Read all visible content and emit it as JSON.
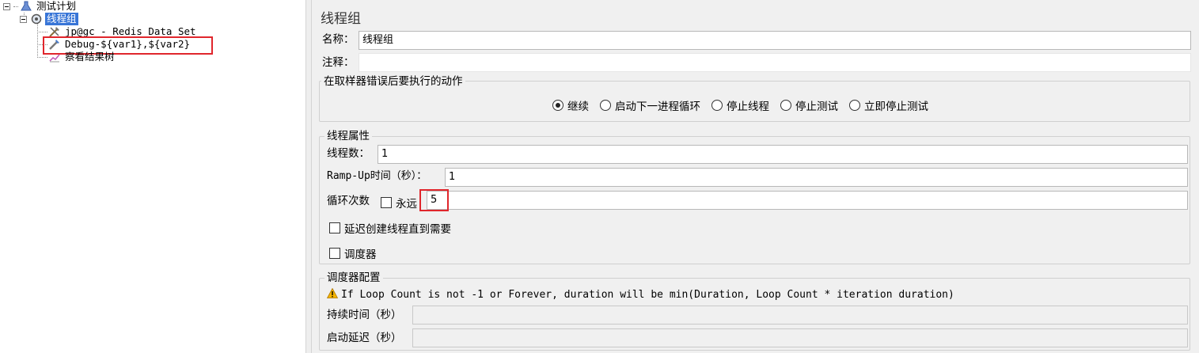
{
  "tree": {
    "items": [
      {
        "label": "测试计划",
        "icon": "flask-icon"
      },
      {
        "label": "线程组",
        "icon": "gear-icon"
      },
      {
        "label": "jp@gc - Redis Data Set",
        "icon": "tools-icon"
      },
      {
        "label": "Debug-${var1},${var2}",
        "icon": "pipette-icon"
      },
      {
        "label": "察看结果树",
        "icon": "chart-icon"
      }
    ]
  },
  "panel": {
    "title": "线程组",
    "name_label": "名称：",
    "name_value": "线程组",
    "comment_label": "注释：",
    "comment_value": "",
    "sampler_error": {
      "title": "在取样器错误后要执行的动作",
      "options": [
        "继续",
        "启动下一进程循环",
        "停止线程",
        "停止测试",
        "立即停止测试"
      ],
      "selected": "继续"
    },
    "thread_props": {
      "title": "线程属性",
      "threads_label": "线程数：",
      "threads_value": "1",
      "rampup_label": "Ramp-Up时间（秒）：",
      "rampup_value": "1",
      "loop_label": "循环次数",
      "forever_label": "永远",
      "forever_checked": false,
      "loop_value": "5",
      "delay_label": "延迟创建线程直到需要",
      "delay_checked": false,
      "scheduler_label": "调度器",
      "scheduler_checked": false
    },
    "scheduler_config": {
      "title": "调度器配置",
      "warning": "If Loop Count is not -1 or Forever, duration will be min(Duration, Loop Count * iteration duration)",
      "warning_icon": "warning-icon",
      "duration_label": "持续时间（秒）",
      "duration_value": "",
      "startup_label": "启动延迟（秒）",
      "startup_value": ""
    }
  },
  "colors": {
    "selection": "#3875d7",
    "highlight_box": "#e0262c",
    "panel_bg": "#f0f0f0"
  }
}
